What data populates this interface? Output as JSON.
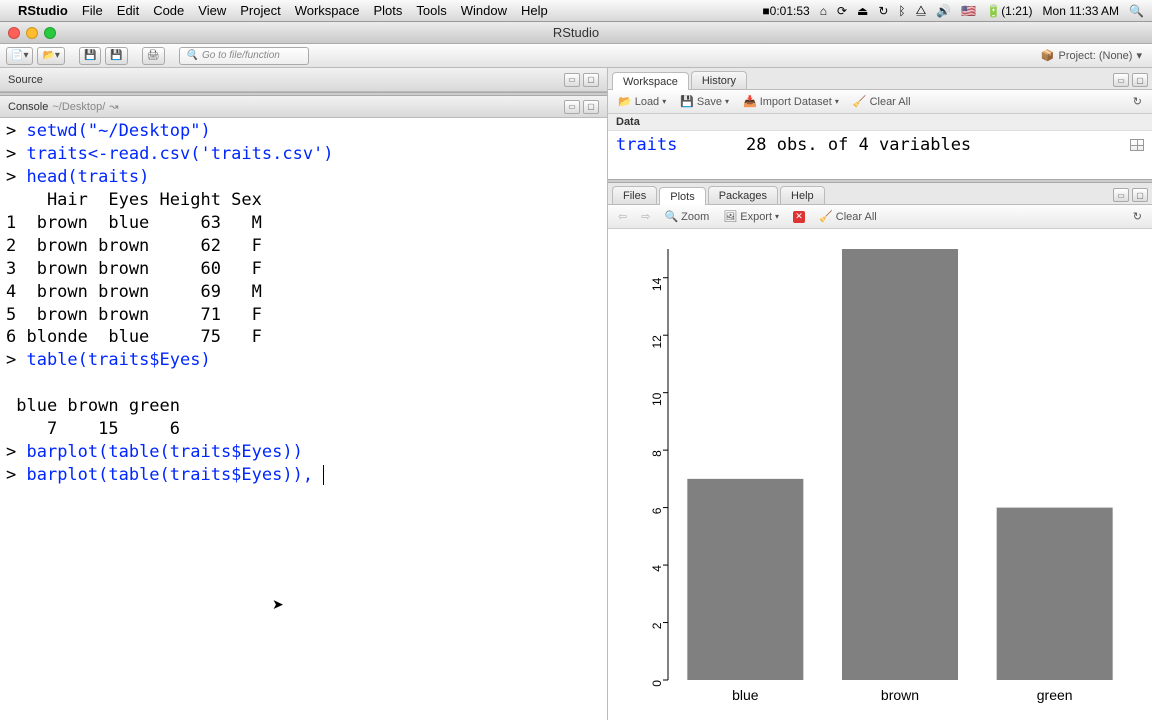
{
  "menubar": {
    "app": "RStudio",
    "items": [
      "File",
      "Edit",
      "Code",
      "View",
      "Project",
      "Workspace",
      "Plots",
      "Tools",
      "Window",
      "Help"
    ],
    "status_time_small": "0:01:53",
    "status_battery": "(1:21)",
    "status_day": "Mon",
    "status_clock": "11:33 AM"
  },
  "window": {
    "title": "RStudio"
  },
  "toolbar": {
    "goto_placeholder": "Go to file/function",
    "project_label": "Project: (None)"
  },
  "source": {
    "label": "Source"
  },
  "console": {
    "label": "Console",
    "path": "~/Desktop/",
    "lines": [
      {
        "prompt": "> ",
        "code": "setwd(\"~/Desktop\")",
        "style": "code"
      },
      {
        "prompt": "> ",
        "code": "traits<-read.csv('traits.csv')",
        "style": "code"
      },
      {
        "prompt": "> ",
        "code": "head(traits)",
        "style": "code"
      },
      {
        "text": "    Hair  Eyes Height Sex",
        "style": "out"
      },
      {
        "text": "1  brown  blue     63   M",
        "style": "out"
      },
      {
        "text": "2  brown brown     62   F",
        "style": "out"
      },
      {
        "text": "3  brown brown     60   F",
        "style": "out"
      },
      {
        "text": "4  brown brown     69   M",
        "style": "out"
      },
      {
        "text": "5  brown brown     71   F",
        "style": "out"
      },
      {
        "text": "6 blonde  blue     75   F",
        "style": "out"
      },
      {
        "prompt": "> ",
        "code": "table(traits$Eyes)",
        "style": "code"
      },
      {
        "text": "",
        "style": "out"
      },
      {
        "text": " blue brown green ",
        "style": "out"
      },
      {
        "text": "    7    15     6 ",
        "style": "out"
      },
      {
        "prompt": "> ",
        "code": "barplot(table(traits$Eyes))",
        "style": "code"
      },
      {
        "prompt": "> ",
        "code": "barplot(table(traits$Eyes)), ",
        "style": "code",
        "cursor": true
      }
    ]
  },
  "workspace": {
    "tabs": [
      "Workspace",
      "History"
    ],
    "active": 0,
    "buttons": {
      "load": "Load",
      "save": "Save",
      "import": "Import Dataset",
      "clear": "Clear All"
    },
    "section": "Data",
    "rows": [
      {
        "name": "traits",
        "desc": "28 obs. of 4 variables"
      }
    ]
  },
  "plots": {
    "tabs": [
      "Files",
      "Plots",
      "Packages",
      "Help"
    ],
    "active": 1,
    "buttons": {
      "zoom": "Zoom",
      "export": "Export",
      "clear": "Clear All"
    }
  },
  "chart_data": {
    "type": "bar",
    "categories": [
      "blue",
      "brown",
      "green"
    ],
    "values": [
      7,
      15,
      6
    ],
    "y_ticks": [
      0,
      2,
      4,
      6,
      8,
      10,
      12,
      14
    ],
    "ylim": [
      0,
      15
    ],
    "bar_color": "#808080"
  }
}
